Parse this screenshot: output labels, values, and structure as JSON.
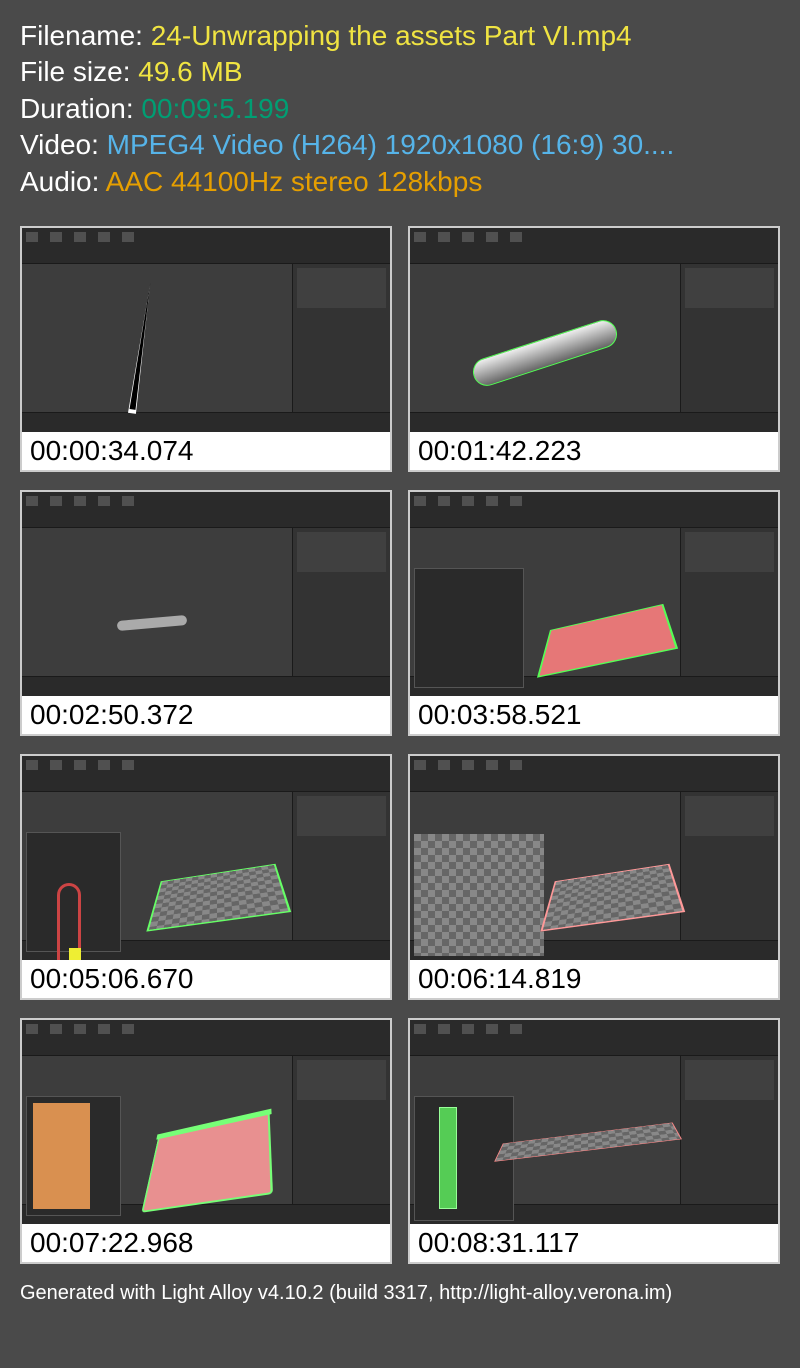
{
  "header": {
    "filename_label": "Filename: ",
    "filename_value": "24-Unwrapping the assets Part VI.mp4",
    "filesize_label": "File size: ",
    "filesize_value": "49.6 MB",
    "duration_label": "Duration: ",
    "duration_value": "00:09:5.199",
    "video_label": "Video: ",
    "video_value": "MPEG4 Video (H264) 1920x1080 (16:9) 30....",
    "audio_label": "Audio: ",
    "audio_value": "AAC 44100Hz stereo 128kbps"
  },
  "thumbnails": [
    {
      "timestamp": "00:00:34.074"
    },
    {
      "timestamp": "00:01:42.223"
    },
    {
      "timestamp": "00:02:50.372"
    },
    {
      "timestamp": "00:03:58.521"
    },
    {
      "timestamp": "00:05:06.670"
    },
    {
      "timestamp": "00:06:14.819"
    },
    {
      "timestamp": "00:07:22.968"
    },
    {
      "timestamp": "00:08:31.117"
    }
  ],
  "footer": {
    "text": "Generated with Light Alloy v4.10.2 (build 3317, http://light-alloy.verona.im)"
  }
}
